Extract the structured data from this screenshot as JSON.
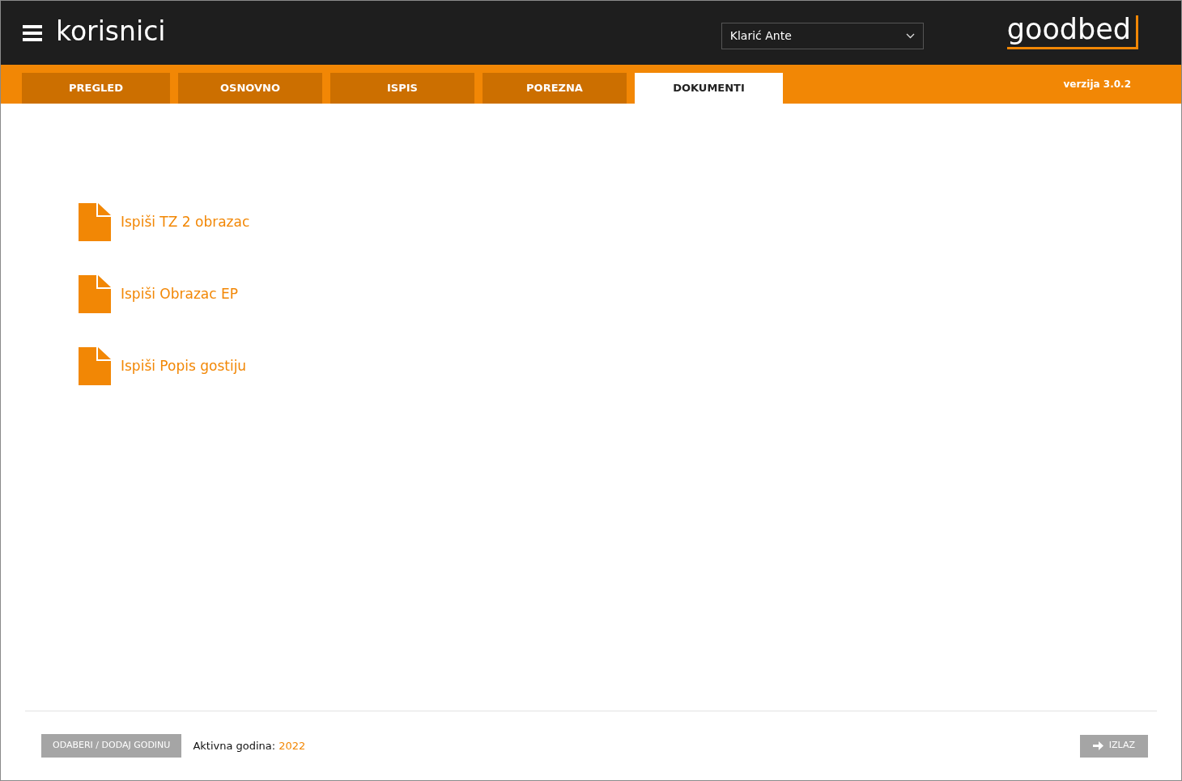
{
  "header": {
    "title": "korisnici",
    "user_select": {
      "value": "Klarić Ante"
    },
    "logo": "goodbed"
  },
  "tabs": [
    {
      "label": "PREGLED",
      "selected": false
    },
    {
      "label": "OSNOVNO",
      "selected": false
    },
    {
      "label": "ISPIS",
      "selected": false
    },
    {
      "label": "POREZNA",
      "selected": false
    },
    {
      "label": "DOKUMENTI",
      "selected": true
    }
  ],
  "version": "verzija 3.0.2",
  "documents": [
    {
      "label": "Ispiši TZ 2 obrazac"
    },
    {
      "label": "Ispiši Obrazac EP"
    },
    {
      "label": "Ispiši Popis gostiju"
    }
  ],
  "footer": {
    "year_button": "ODABERI / DODAJ GODINU",
    "active_year_label": "Aktivna godina:",
    "active_year": "2022",
    "exit_button": "IZLAZ"
  }
}
